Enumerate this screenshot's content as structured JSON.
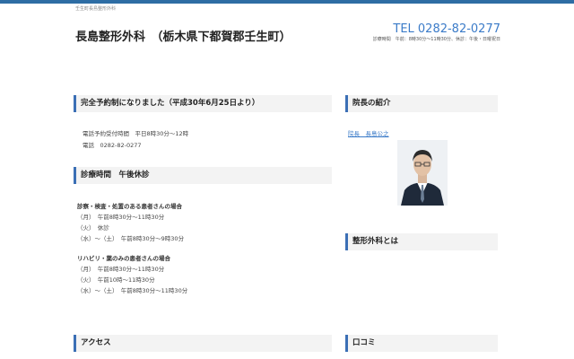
{
  "header": {
    "tagline": "壬生町長島整形外科",
    "title": "長島整形外科　（栃木県下都賀郡壬生町）",
    "tel": "TEL 0282-82-0277",
    "hours": "診療時間　午前：8時30分～11時30分、休診：午後・日曜祝日"
  },
  "reservation": {
    "heading": "完全予約制になりました（平成30年6月25日より）",
    "lines": [
      "電話予約受付時間　平日8時30分～12時",
      "電話　0282-82-0277"
    ]
  },
  "schedule": {
    "heading": "診療時間　午後休診",
    "group1": {
      "title": "診察・検査・処置のある患者さんの場合",
      "rows": [
        "（月）　午前8時30分～11時30分",
        "（火）　休診",
        "（水）～（土）　午前8時30分～9時30分"
      ]
    },
    "group2": {
      "title": "リハビリ・薬のみの患者さんの場合",
      "rows": [
        "（月）　午前8時30分～11時30分",
        "（火）　午前10時～11時30分",
        "（水）～（土）　午前8時30分～11時30分"
      ]
    }
  },
  "access": {
    "heading": "アクセス"
  },
  "sidebar": {
    "director_heading": "院長の紹介",
    "director_link": "院長　長島公之",
    "ortho_heading": "整形外科とは",
    "reviews_heading": "口コミ"
  }
}
